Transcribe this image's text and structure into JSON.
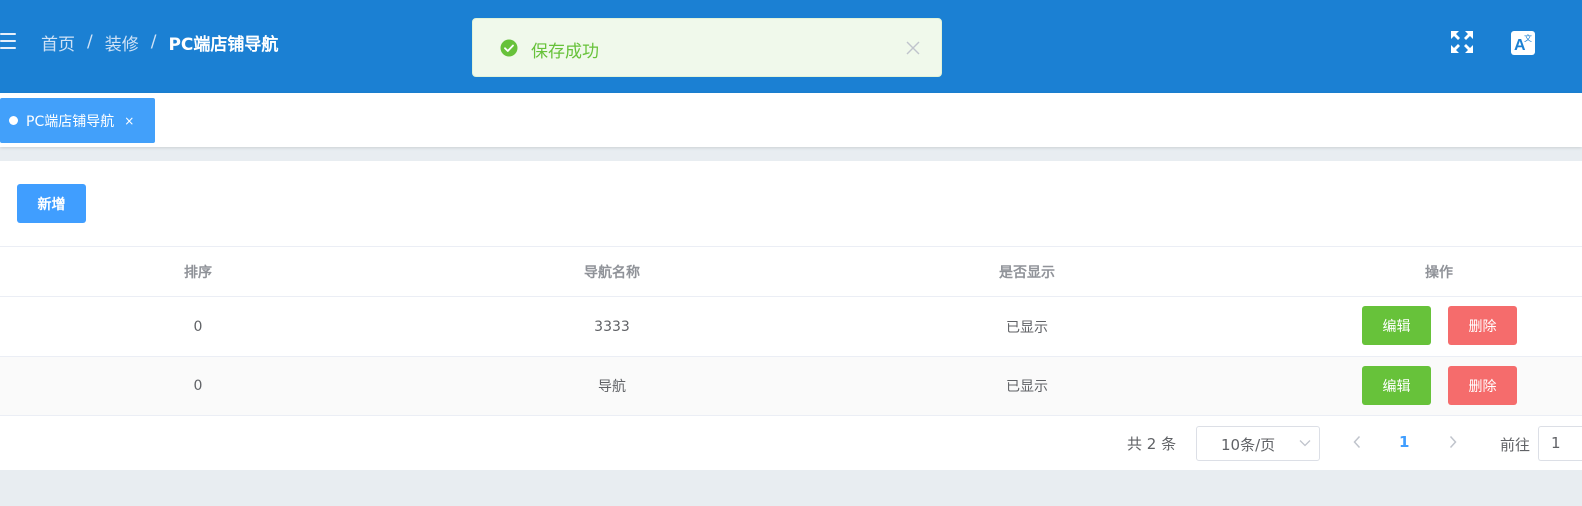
{
  "header": {
    "breadcrumb": [
      "首页",
      "装修",
      "PC端店铺导航"
    ],
    "separator": "/",
    "icons": [
      "menu-icon",
      "fullscreen-icon",
      "language-icon"
    ]
  },
  "toast": {
    "type": "success",
    "message": "保存成功",
    "icons": [
      "success-check-icon",
      "close-icon"
    ]
  },
  "tabs": [
    {
      "label": "PC端店铺导航",
      "active": true,
      "close": "×"
    }
  ],
  "toolbar": {
    "add_label": "新增"
  },
  "table": {
    "columns": [
      "排序",
      "导航名称",
      "是否显示",
      "操作"
    ],
    "rows": [
      {
        "sort": "0",
        "name": "3333",
        "visible": "已显示",
        "edit": "编辑",
        "delete": "删除"
      },
      {
        "sort": "0",
        "name": "导航",
        "visible": "已显示",
        "edit": "编辑",
        "delete": "删除"
      }
    ]
  },
  "pagination": {
    "total": "共 2 条",
    "page_size": "10条/页",
    "current_page": "1",
    "goto_label": "前往",
    "goto_value": "1"
  },
  "colors": {
    "header_bg": "#1b80d3",
    "primary": "#409eff",
    "success": "#67c23a",
    "danger": "#f56c6c",
    "toast_bg": "#f0f9eb"
  }
}
